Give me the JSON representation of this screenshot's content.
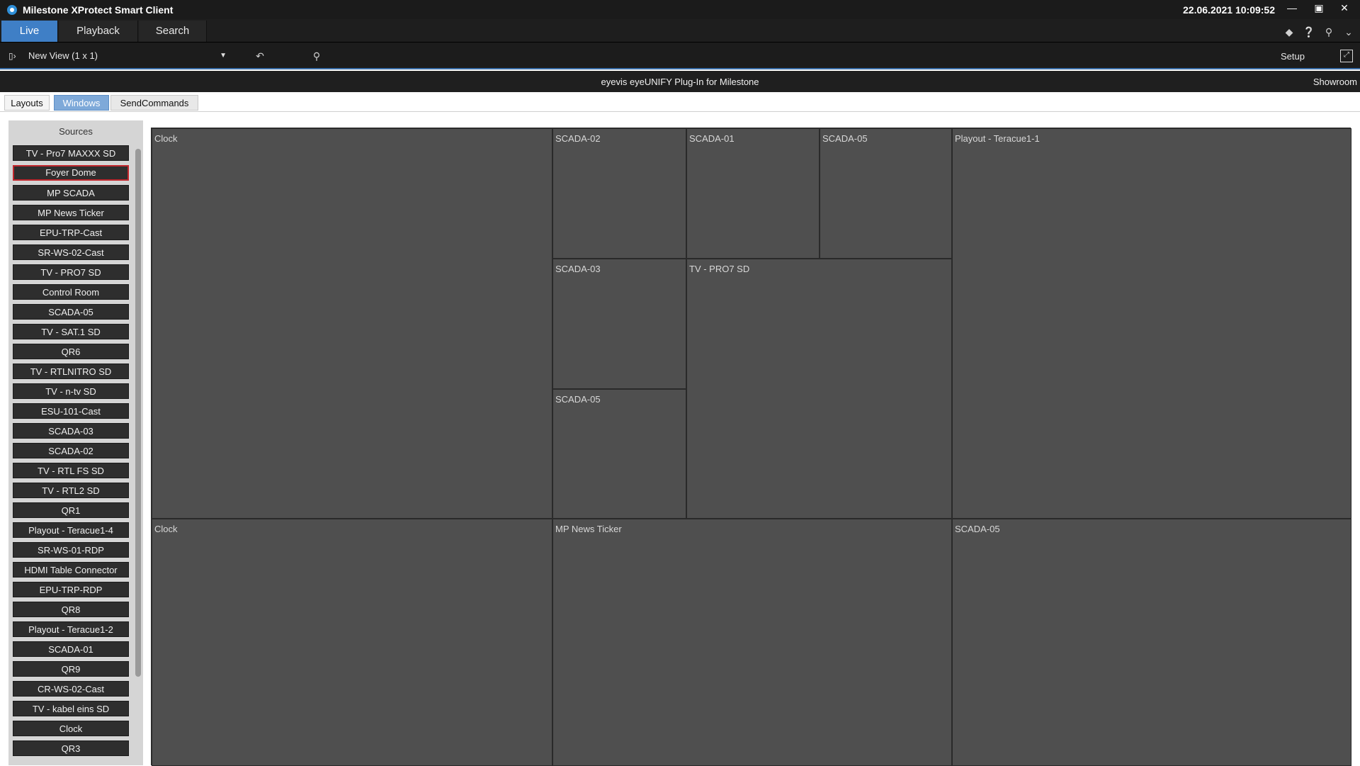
{
  "app": {
    "title": "Milestone XProtect Smart Client",
    "datetime": "22.06.2021 10:09:52",
    "icons": {
      "app": "milestone-logo",
      "minimize": "minimize-icon",
      "maximize": "maximize-icon",
      "close": "close-icon"
    }
  },
  "tabs": [
    {
      "label": "Live"
    },
    {
      "label": "Playback"
    },
    {
      "label": "Search"
    }
  ],
  "tab_icons": [
    "connection-icon",
    "help-icon",
    "pin-icon",
    "chevron-down-icon"
  ],
  "view": {
    "name": "New View (1 x 1)",
    "setup_label": "Setup",
    "icons": [
      "view-switch-icon",
      "undo-icon",
      "search-frame-icon",
      "fullscreen-icon"
    ]
  },
  "plugin": {
    "title": "eyevis eyeUNIFY Plug-In for Milestone",
    "room": "Showroom"
  },
  "subtabs": [
    {
      "label": "Layouts"
    },
    {
      "label": "Windows"
    },
    {
      "label": "SendCommands"
    }
  ],
  "sources": {
    "header": "Sources",
    "items": [
      "TV - Pro7 MAXXX SD",
      "Foyer Dome",
      "MP SCADA",
      "MP News Ticker",
      "EPU-TRP-Cast",
      "SR-WS-02-Cast",
      "TV - PRO7 SD",
      "Control Room",
      "SCADA-05",
      "TV - SAT.1 SD",
      "QR6",
      "TV - RTLNITRO SD",
      "TV - n-tv SD",
      "ESU-101-Cast",
      "SCADA-03",
      "SCADA-02",
      "TV - RTL FS SD",
      "TV - RTL2 SD",
      "QR1",
      "Playout - Teracue1-4",
      "SR-WS-01-RDP",
      "HDMI Table Connector",
      "EPU-TRP-RDP",
      "QR8",
      "Playout - Teracue1-2",
      "SCADA-01",
      "QR9",
      "CR-WS-02-Cast",
      "TV - kabel eins SD",
      "Clock",
      "QR3"
    ]
  },
  "windows": [
    "Clock",
    "SCADA-02",
    "SCADA-01",
    "SCADA-05",
    "Playout - Teracue1-1",
    "SCADA-03",
    "TV - PRO7 SD",
    "SCADA-05",
    "Clock",
    "MP News Ticker",
    "SCADA-05"
  ]
}
